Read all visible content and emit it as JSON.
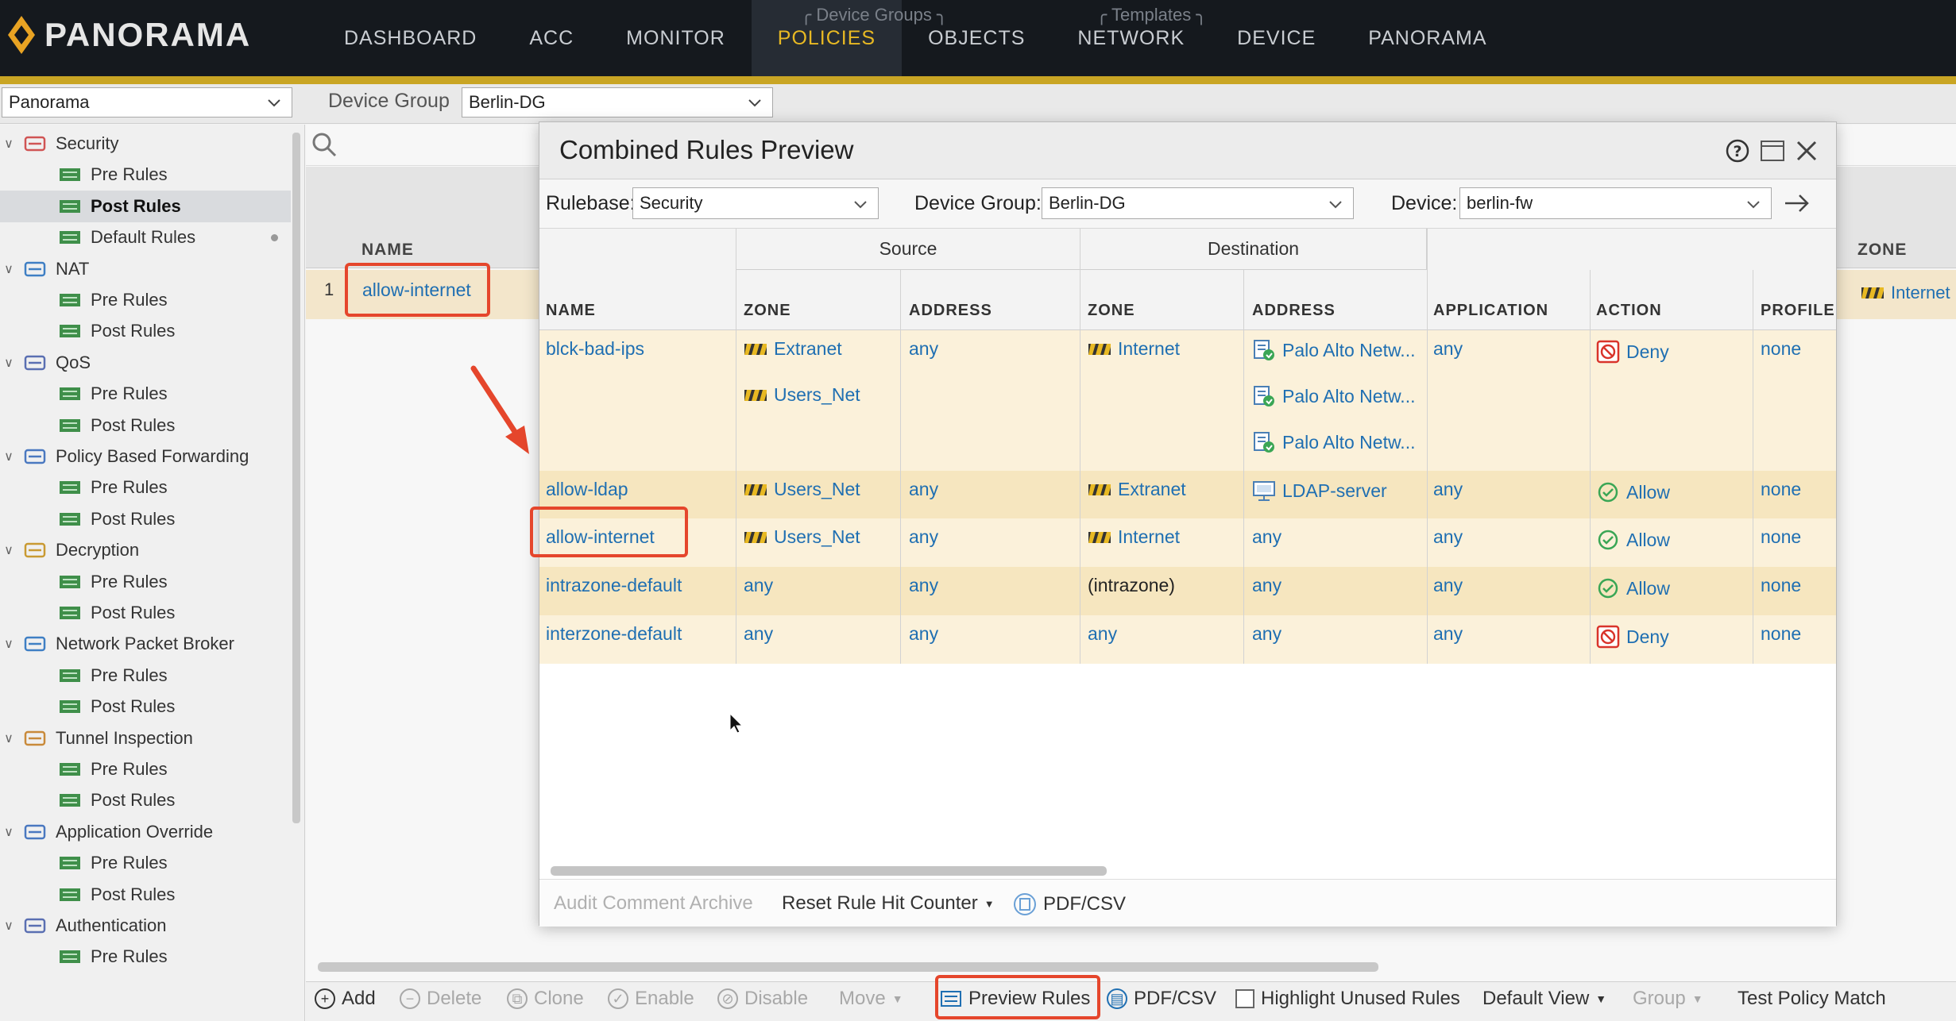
{
  "topbar": {
    "logo_text": "PANORAMA",
    "nav": [
      "DASHBOARD",
      "ACC",
      "MONITOR",
      "POLICIES",
      "OBJECTS",
      "NETWORK",
      "DEVICE",
      "PANORAMA"
    ],
    "active_nav": "POLICIES",
    "group_device_groups": "Device Groups",
    "group_templates": "Templates",
    "accent_color": "#e8b923"
  },
  "subbar": {
    "context_select": "Panorama",
    "device_group_label": "Device Group",
    "device_group_value": "Berlin-DG"
  },
  "sidebar": {
    "sections": [
      {
        "label": "Security",
        "children": [
          "Pre Rules",
          "Post Rules",
          "Default Rules"
        ]
      },
      {
        "label": "NAT",
        "children": [
          "Pre Rules",
          "Post Rules"
        ]
      },
      {
        "label": "QoS",
        "children": [
          "Pre Rules",
          "Post Rules"
        ]
      },
      {
        "label": "Policy Based Forwarding",
        "children": [
          "Pre Rules",
          "Post Rules"
        ]
      },
      {
        "label": "Decryption",
        "children": [
          "Pre Rules",
          "Post Rules"
        ]
      },
      {
        "label": "Network Packet Broker",
        "children": [
          "Pre Rules",
          "Post Rules"
        ]
      },
      {
        "label": "Tunnel Inspection",
        "children": [
          "Pre Rules",
          "Post Rules"
        ]
      },
      {
        "label": "Application Override",
        "children": [
          "Pre Rules",
          "Post Rules"
        ]
      },
      {
        "label": "Authentication",
        "children": [
          "Pre Rules"
        ]
      }
    ],
    "selected": "Security / Post Rules"
  },
  "background_table": {
    "col_name": "NAME",
    "col_zone": "ZONE",
    "row_number": "1",
    "row_name": "allow-internet",
    "row_zone": "Internet"
  },
  "bottom_toolbar": {
    "add": "Add",
    "delete": "Delete",
    "clone": "Clone",
    "enable": "Enable",
    "disable": "Disable",
    "move": "Move",
    "preview_rules": "Preview Rules",
    "pdf_csv": "PDF/CSV",
    "highlight_unused": "Highlight Unused Rules",
    "default_view": "Default View",
    "group": "Group",
    "test_policy_match": "Test Policy Match"
  },
  "modal": {
    "title": "Combined Rules Preview",
    "rulebase_label": "Rulebase:",
    "rulebase_value": "Security",
    "device_group_label": "Device Group:",
    "device_group_value": "Berlin-DG",
    "device_label": "Device:",
    "device_value": "berlin-fw",
    "group_source": "Source",
    "group_destination": "Destination",
    "columns": {
      "name": "NAME",
      "src_zone": "ZONE",
      "src_address": "ADDRESS",
      "dst_zone": "ZONE",
      "dst_address": "ADDRESS",
      "application": "APPLICATION",
      "action": "ACTION",
      "profile": "PROFILE"
    },
    "rows": [
      {
        "name": "blck-bad-ips",
        "src_zone": [
          "Extranet",
          "Users_Net"
        ],
        "src_address": "any",
        "dst_zone": "Internet",
        "dst_address": [
          "Palo Alto Netw...",
          "Palo Alto Netw...",
          "Palo Alto Netw..."
        ],
        "application": "any",
        "action": "Deny",
        "profile": "none"
      },
      {
        "name": "allow-ldap",
        "src_zone": [
          "Users_Net"
        ],
        "src_address": "any",
        "dst_zone": "Extranet",
        "dst_address": [
          "LDAP-server"
        ],
        "application": "any",
        "action": "Allow",
        "profile": "none"
      },
      {
        "name": "allow-internet",
        "src_zone": [
          "Users_Net"
        ],
        "src_address": "any",
        "dst_zone": "Internet",
        "dst_address": [
          "any"
        ],
        "application": "any",
        "action": "Allow",
        "profile": "none"
      },
      {
        "name": "intrazone-default",
        "src_zone": [
          "any"
        ],
        "src_address": "any",
        "dst_zone": "(intrazone)",
        "dst_address": [
          "any"
        ],
        "application": "any",
        "action": "Allow",
        "profile": "none"
      },
      {
        "name": "interzone-default",
        "src_zone": [
          "any"
        ],
        "src_address": "any",
        "dst_zone": "any",
        "dst_address": [
          "any"
        ],
        "application": "any",
        "action": "Deny",
        "profile": "none"
      }
    ],
    "footer": {
      "audit": "Audit Comment Archive",
      "reset": "Reset Rule Hit Counter",
      "pdf_csv": "PDF/CSV"
    },
    "colors": {
      "row_a": "#fbf1da",
      "row_b": "#f6e6bf",
      "link": "#1f6fb2",
      "deny": "#d9342b",
      "allow": "#3aa655"
    }
  }
}
